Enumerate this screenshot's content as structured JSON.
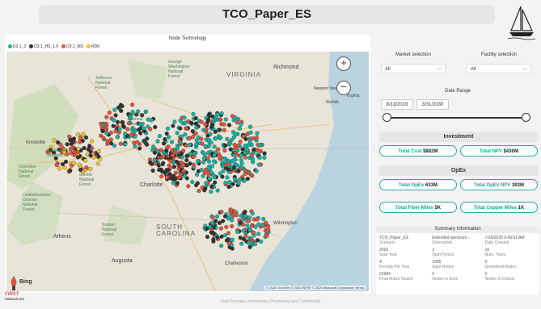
{
  "header": {
    "title": "TCO_Paper_ES"
  },
  "map": {
    "title": "Node Technology",
    "legend": [
      {
        "label": "D3.1_2",
        "color": "#17b2a6"
      },
      {
        "label": "D3.1_HS_1.6",
        "color": "#333333"
      },
      {
        "label": "D3.1_MS",
        "color": "#e0533e"
      },
      {
        "label": "RDK",
        "color": "#f2c12e"
      }
    ],
    "labels": {
      "virginia": "VIRGINIA",
      "richmond": "Richmond",
      "newport_news": "Newport News",
      "norfolk": "Norfolk",
      "virginia_beach": "Virginia",
      "charlotte": "Charlotte",
      "south_carolina": "SOUTH CAROLINA",
      "athens": "Athens",
      "augusta": "Augusta",
      "knoxville": "Knoxville",
      "forest1": "Jefferson National Forest",
      "forest2": "Cherokee National Forest",
      "forest3": "Chattahoochee-Oconee National Forest",
      "forest4": "Sumter National Forest",
      "forest5": "Sumter National Forest",
      "forest6": "Great Smoky Mountains",
      "forest7": "George Washington National Forest",
      "forest8": "Jefferson National Forest",
      "wilmington": "Wilmington",
      "charleston": "Charleston"
    },
    "zoom_in": "+",
    "zoom_out": "−",
    "attribution": "© 2020 TomTom © 2020 HERE © 2020 Microsoft Corporation  Terms",
    "provider": "Bing"
  },
  "filters": {
    "market_label": "Market selection",
    "market_value": "All",
    "facility_label": "Facility selection",
    "facility_value": "All",
    "date_label": "Date Range",
    "date_start": "8/13/2019",
    "date_end": "3/31/2030"
  },
  "investment": {
    "header": "Investment",
    "total_cost_label": "Total Cost",
    "total_cost_value": "$882M",
    "total_npv_label": "Total NPV",
    "total_npv_value": "$430M"
  },
  "opex": {
    "header": "OpEx",
    "total_opex_label": "Total OpEx",
    "total_opex_value": "633M",
    "total_opex_npv_label": "Total OpEx NPV",
    "total_opex_npv_value": "393M"
  },
  "miles": {
    "fiber_label": "Total Fiber Miles",
    "fiber_value": "5K",
    "copper_label": "Total Copper Miles",
    "copper_value": "1K"
  },
  "summary": {
    "title": "Summary Information",
    "rows": [
      [
        {
          "v": "TCO_Paper_ES",
          "k": "Scenario"
        },
        {
          "v": "Extended spectrum...",
          "k": "Description"
        },
        {
          "v": "7/26/2020 9:49:51 AM",
          "k": "Date Created"
        }
      ],
      [
        {
          "v": "2020",
          "k": "Start Year"
        },
        {
          "v": "2",
          "k": "Start Period"
        },
        {
          "v": "10",
          "k": "Num. Years"
        }
      ],
      [
        {
          "v": "4",
          "k": "Periods Per Year"
        },
        {
          "v": "1945",
          "k": "Input Nodes"
        },
        {
          "v": "0",
          "k": "Greenfield Nodes"
        }
      ],
      [
        {
          "v": "21984",
          "k": "Final Active Nodes"
        },
        {
          "v": "0",
          "k": "Nodes in Error"
        },
        {
          "v": "0",
          "k": "Nodes in Critical"
        }
      ]
    ]
  },
  "footer": {
    "text": "First Principles Innovations Proprietary and Confidential",
    "logo_line1": "FIRST",
    "logo_line2": "PRINCIPLES"
  }
}
